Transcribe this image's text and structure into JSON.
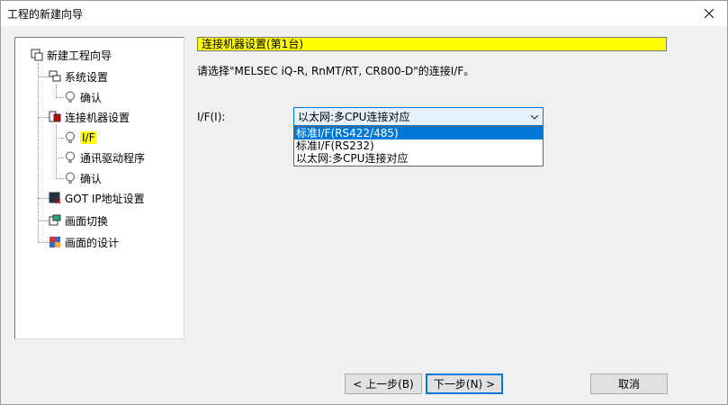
{
  "window": {
    "title": "工程的新建向导"
  },
  "tree": {
    "root": "新建工程向导",
    "items": [
      {
        "label": "系统设置"
      },
      {
        "label": "确认"
      },
      {
        "label": "连接机器设置"
      },
      {
        "label": "I/F"
      },
      {
        "label": "通讯驱动程序"
      },
      {
        "label": "确认"
      },
      {
        "label": "GOT IP地址设置"
      },
      {
        "label": "画面切换"
      },
      {
        "label": "画面的设计"
      }
    ]
  },
  "main": {
    "section_header": "连接机器设置(第1台)",
    "description": "请选择\"MELSEC iQ-R, RnMT/RT, CR800-D\"的连接I/F。",
    "if_label": "I/F(I):",
    "if_select": {
      "value": "以太网:多CPU连接对应",
      "options": [
        "标准I/F(RS422/485)",
        "标准I/F(RS232)",
        "以太网:多CPU连接对应"
      ]
    }
  },
  "buttons": {
    "back": "< 上一步(B)",
    "next": "下一步(N) >",
    "cancel": "取消"
  }
}
